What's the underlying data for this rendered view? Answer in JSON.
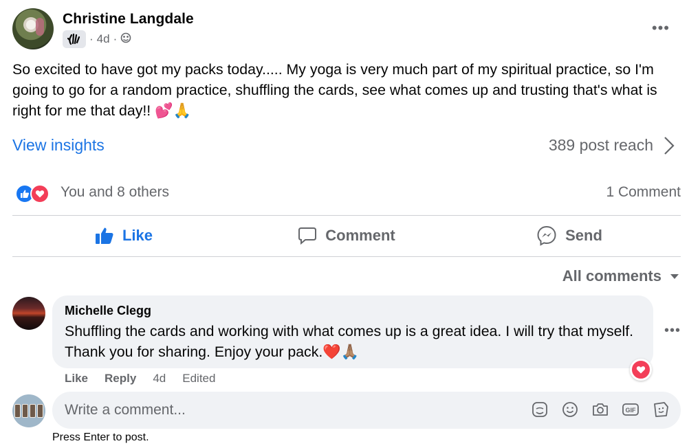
{
  "post": {
    "author": "Christine Langdale",
    "time": "4d",
    "separator": "·",
    "text": "So excited to have got my packs today..... My yoga is very much part of my spiritual practice, so I'm going to go for a random practice, shuffling the cards, see what comes up and trusting that's what is right for me that day!! 💕🙏"
  },
  "insights": {
    "link": "View insights",
    "reach": "389 post reach"
  },
  "reactions": {
    "summary": "You and 8 others",
    "comments": "1 Comment"
  },
  "actions": {
    "like": "Like",
    "comment": "Comment",
    "send": "Send"
  },
  "filter": {
    "label": "All comments"
  },
  "comment": {
    "author": "Michelle Clegg",
    "text": "Shuffling the cards and working with what comes up is a great idea. I will try that myself. Thank you for sharing. Enjoy your pack.❤️🙏🏽",
    "like": "Like",
    "reply": "Reply",
    "time": "4d",
    "edited": "Edited"
  },
  "composer": {
    "placeholder": "Write a comment...",
    "hint": "Press Enter to post."
  },
  "colors": {
    "accent": "#1b74e4",
    "secondary_text": "#65676b",
    "bubble": "#f0f2f5",
    "love": "#f33e58"
  },
  "icons": [
    "wave-hand-icon",
    "globe-icon",
    "more-icon",
    "chevron-right-icon",
    "like-reaction-icon",
    "love-reaction-icon",
    "thumbs-up-icon",
    "comment-icon",
    "messenger-icon",
    "caret-down-icon",
    "sticker-icon",
    "emoji-icon",
    "camera-icon",
    "gif-icon",
    "avatar-sticker-icon"
  ]
}
